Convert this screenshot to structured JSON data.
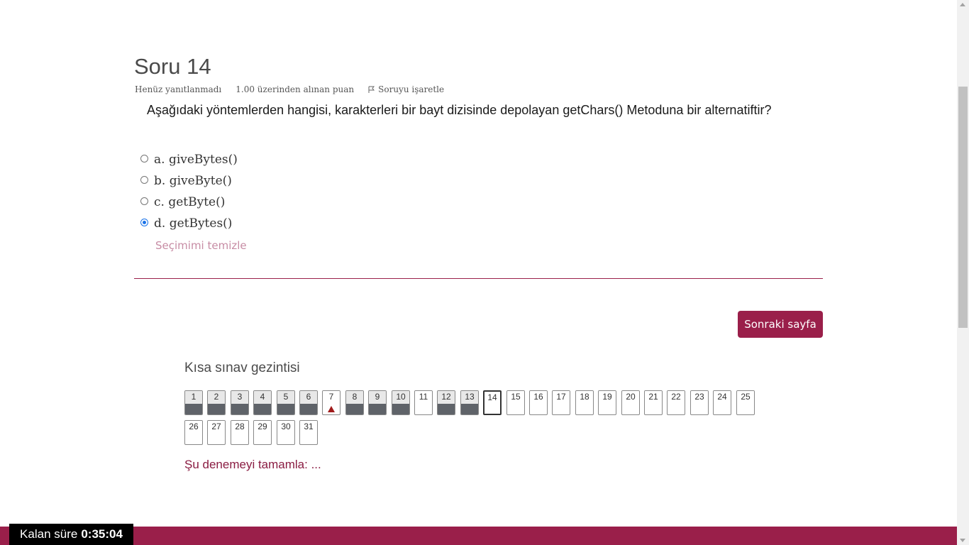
{
  "question": {
    "title": "Soru 14",
    "status": "Henüz yanıtlanmadı",
    "points": "1.00 üzerinden alınan puan",
    "flag_label": "Soruyu işaretle",
    "text": "Aşağıdaki yöntemlerden hangisi, karakterleri bir bayt dizisinde depolayan getChars() Metoduna bir alternatiftir?",
    "options": [
      {
        "label": "a. giveBytes()",
        "selected": false
      },
      {
        "label": "b. giveByte()",
        "selected": false
      },
      {
        "label": "c. getByte()",
        "selected": false
      },
      {
        "label": "d. getBytes()",
        "selected": true
      }
    ],
    "clear_label": "Seçimimi temizle"
  },
  "next_button": "Sonraki sayfa",
  "navigation": {
    "title": "Kısa sınav gezintisi",
    "items": [
      {
        "n": "1",
        "state": "answered"
      },
      {
        "n": "2",
        "state": "answered"
      },
      {
        "n": "3",
        "state": "answered"
      },
      {
        "n": "4",
        "state": "answered"
      },
      {
        "n": "5",
        "state": "answered"
      },
      {
        "n": "6",
        "state": "answered"
      },
      {
        "n": "7",
        "state": "flagged"
      },
      {
        "n": "8",
        "state": "answered"
      },
      {
        "n": "9",
        "state": "answered"
      },
      {
        "n": "10",
        "state": "answered"
      },
      {
        "n": "11",
        "state": "empty"
      },
      {
        "n": "12",
        "state": "answered"
      },
      {
        "n": "13",
        "state": "answered"
      },
      {
        "n": "14",
        "state": "current"
      },
      {
        "n": "15",
        "state": "empty"
      },
      {
        "n": "16",
        "state": "empty"
      },
      {
        "n": "17",
        "state": "empty"
      },
      {
        "n": "18",
        "state": "empty"
      },
      {
        "n": "19",
        "state": "empty"
      },
      {
        "n": "20",
        "state": "empty"
      },
      {
        "n": "21",
        "state": "empty"
      },
      {
        "n": "22",
        "state": "empty"
      },
      {
        "n": "23",
        "state": "empty"
      },
      {
        "n": "24",
        "state": "empty"
      },
      {
        "n": "25",
        "state": "empty"
      },
      {
        "n": "26",
        "state": "empty"
      },
      {
        "n": "27",
        "state": "empty"
      },
      {
        "n": "28",
        "state": "empty"
      },
      {
        "n": "29",
        "state": "empty"
      },
      {
        "n": "30",
        "state": "empty"
      },
      {
        "n": "31",
        "state": "empty"
      }
    ],
    "finish_label": "Şu denemeyi tamamla: ..."
  },
  "timer": {
    "label": "Kalan süre",
    "value": "0:35:04"
  },
  "colors": {
    "brand": "#9a1f4a",
    "answered_fill": "#5f6369",
    "flag": "#a01b1b"
  }
}
